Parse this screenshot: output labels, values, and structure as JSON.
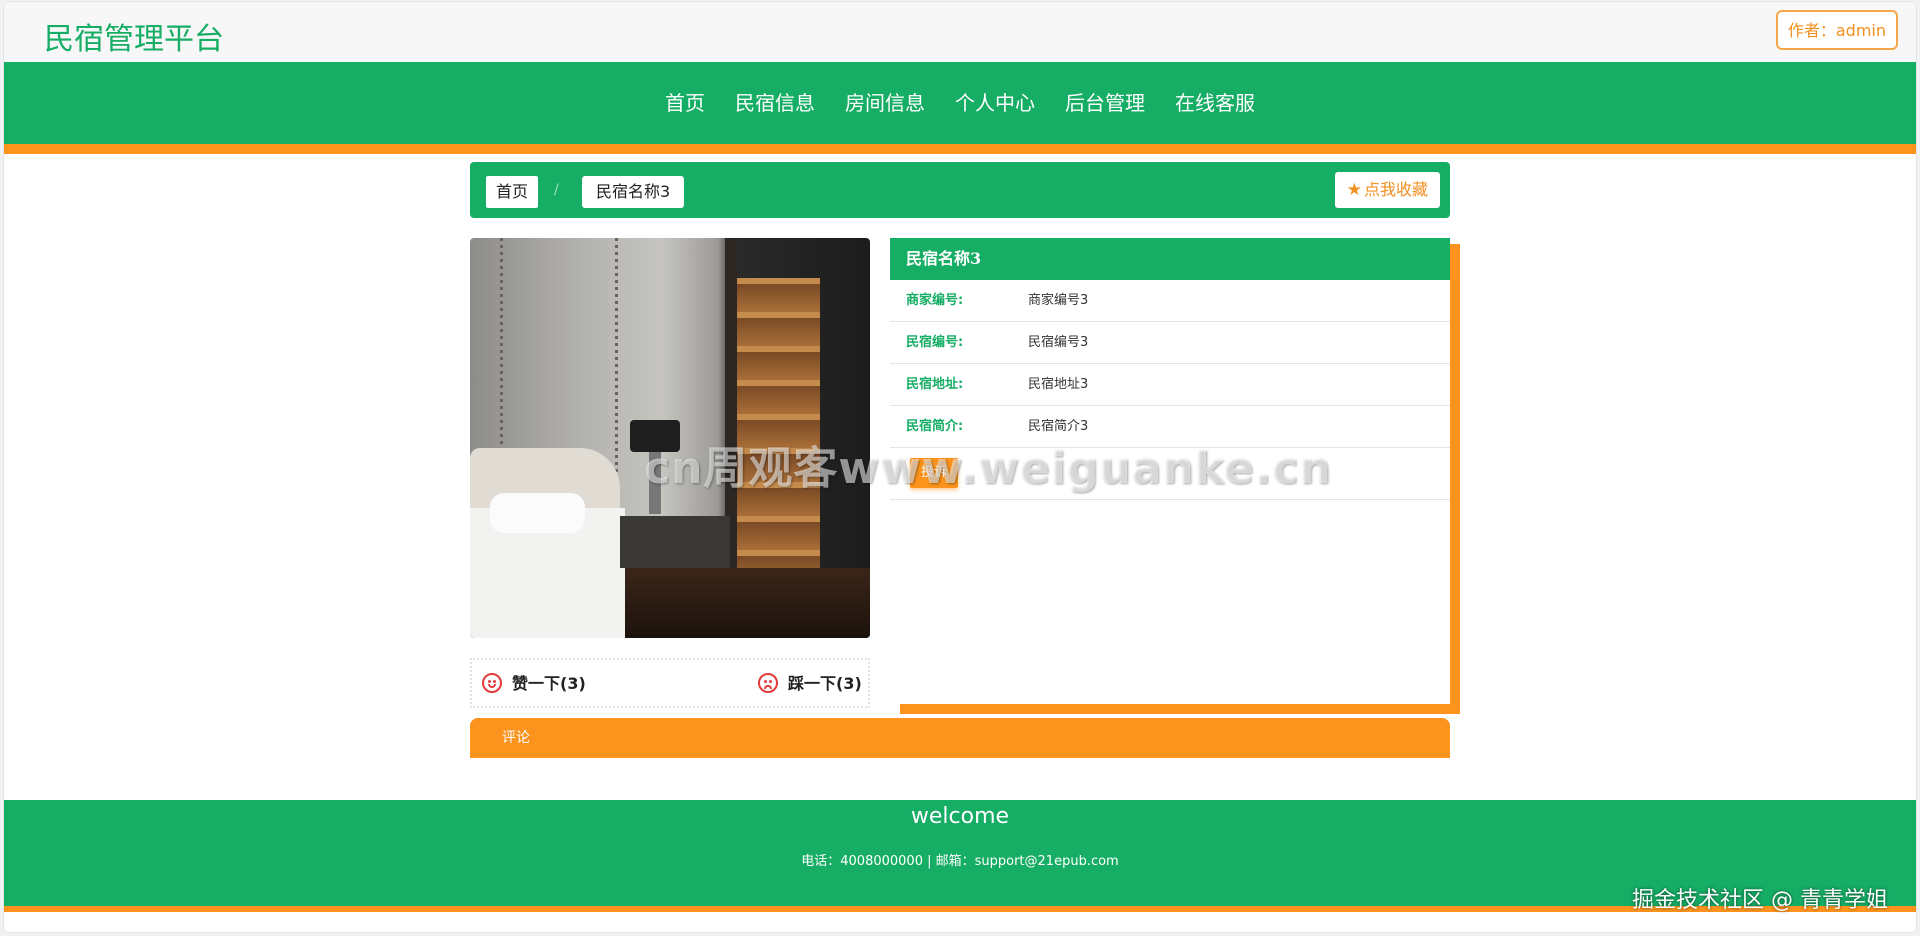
{
  "site": {
    "title": "民宿管理平台",
    "author_label": "作者：admin"
  },
  "nav": {
    "items": [
      "首页",
      "民宿信息",
      "房间信息",
      "个人中心",
      "后台管理",
      "在线客服"
    ]
  },
  "breadcrumb": {
    "home": "首页",
    "separator": "/",
    "current": "民宿名称3"
  },
  "favorite": {
    "label": "点我收藏",
    "icon": "star-icon"
  },
  "votes": {
    "like_label": "赞一下(3)",
    "dislike_label": "踩一下(3)",
    "like_icon": "smile-icon",
    "dislike_icon": "frown-icon"
  },
  "detail": {
    "title": "民宿名称3",
    "rows": [
      {
        "label": "商家编号:",
        "value": "商家编号3"
      },
      {
        "label": "民宿编号:",
        "value": "民宿编号3"
      },
      {
        "label": "民宿地址:",
        "value": "民宿地址3"
      },
      {
        "label": "民宿简介:",
        "value": "民宿简介3"
      }
    ],
    "complain_label": "投诉"
  },
  "comments": {
    "label": "评论"
  },
  "footer": {
    "title": "welcome",
    "contact": "电话：4008000000 | 邮箱：support@21epub.com"
  },
  "overlay": {
    "watermark": "cn周观客www.weiguanke.cn",
    "credit": "掘金技术社区 @ 青青学姐"
  },
  "colors": {
    "primary": "#16ad65",
    "accent": "#fb931c"
  }
}
